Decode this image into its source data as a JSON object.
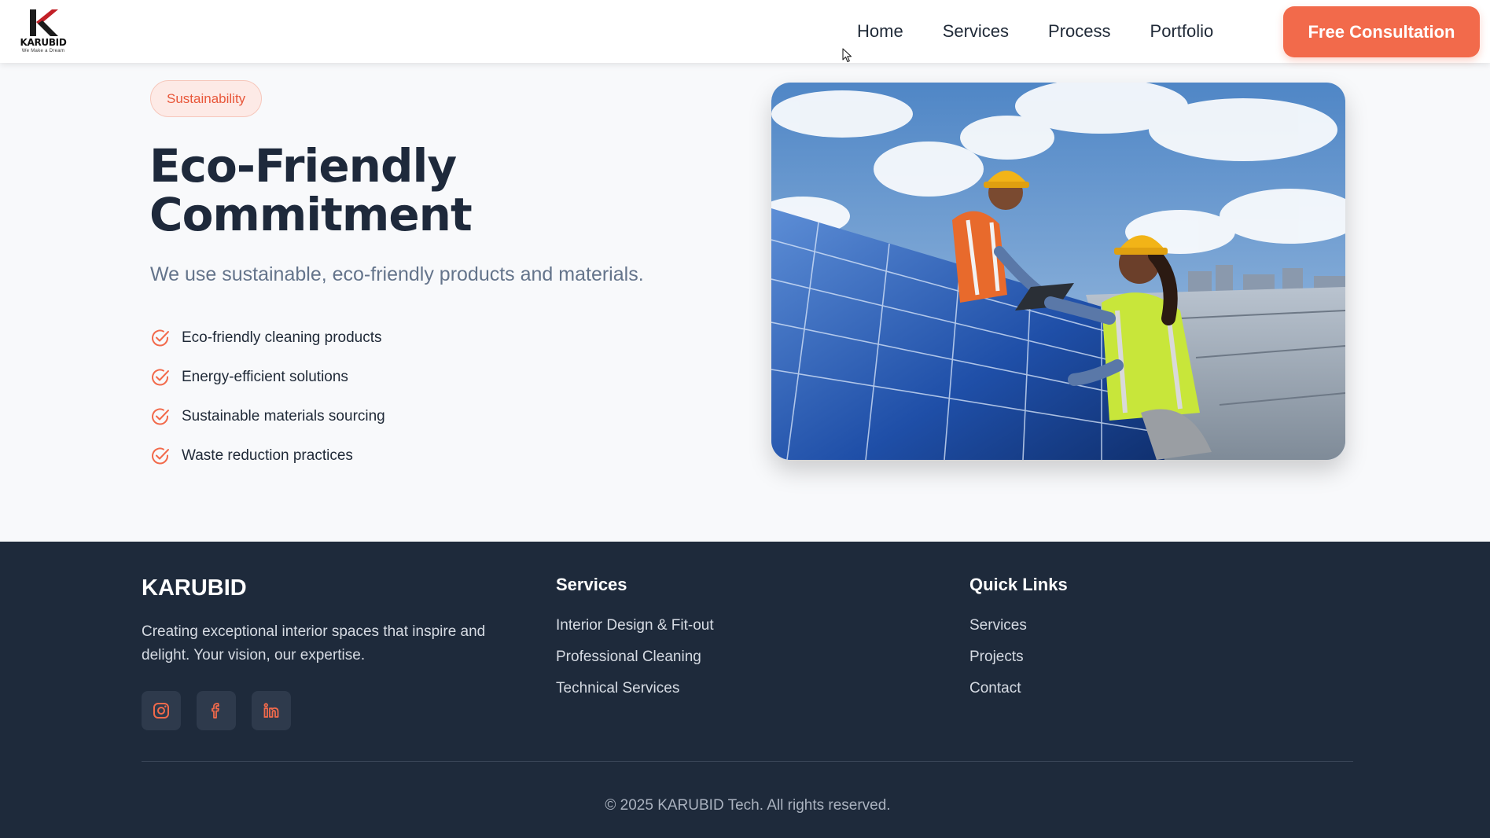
{
  "brand": {
    "logo_word": "KARUBID",
    "logo_tagline": "We Make a Dream",
    "logo_icon": "k-letter-logo-icon"
  },
  "nav": {
    "items": [
      {
        "label": "Home"
      },
      {
        "label": "Services"
      },
      {
        "label": "Process"
      },
      {
        "label": "Portfolio"
      }
    ],
    "cta": "Free Consultation"
  },
  "hero": {
    "badge": "Sustainability",
    "title_line1": "Eco-Friendly",
    "title_line2": "Commitment",
    "subtitle": "We use sustainable, eco-friendly products and materials.",
    "features": [
      {
        "label": "Eco-friendly cleaning products",
        "icon": "check-circle-icon"
      },
      {
        "label": "Energy-efficient solutions",
        "icon": "check-circle-icon"
      },
      {
        "label": "Sustainable materials sourcing",
        "icon": "check-circle-icon"
      },
      {
        "label": "Waste reduction practices",
        "icon": "check-circle-icon"
      }
    ],
    "image": "workers-installing-solar-panels-photo"
  },
  "footer": {
    "brand": "KARUBID",
    "description": "Creating exceptional interior spaces that inspire and delight. Your vision, our expertise.",
    "socials": [
      {
        "icon": "instagram-icon"
      },
      {
        "icon": "facebook-icon"
      },
      {
        "icon": "linkedin-icon"
      }
    ],
    "services_title": "Services",
    "services": [
      {
        "label": "Interior Design & Fit-out"
      },
      {
        "label": "Professional Cleaning"
      },
      {
        "label": "Technical Services"
      }
    ],
    "links_title": "Quick Links",
    "links": [
      {
        "label": "Services"
      },
      {
        "label": "Projects"
      },
      {
        "label": "Contact"
      }
    ],
    "copyright": "© 2025 KARUBID Tech. All rights reserved."
  },
  "colors": {
    "accent": "#f26a4b",
    "footer_bg": "#1e2a3b",
    "heading": "#1e293b",
    "page_bg": "#f8f9fb"
  }
}
